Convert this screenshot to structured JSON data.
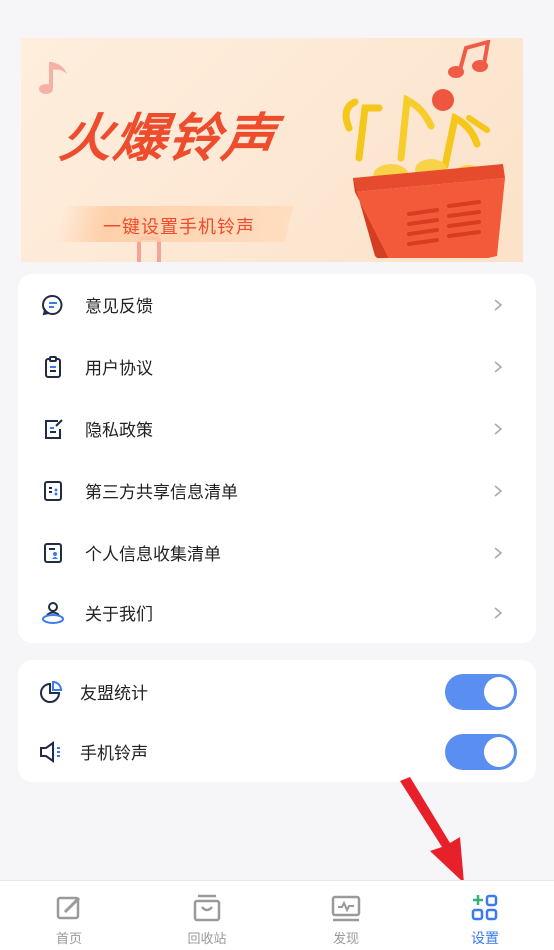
{
  "banner": {
    "title": "火爆铃声",
    "subtitle": "一键设置手机铃声"
  },
  "menu": {
    "items": [
      {
        "label": "意见反馈",
        "icon": "feedback-icon"
      },
      {
        "label": "用户协议",
        "icon": "clipboard-icon"
      },
      {
        "label": "隐私政策",
        "icon": "edit-document-icon"
      },
      {
        "label": "第三方共享信息清单",
        "icon": "share-list-icon"
      },
      {
        "label": "个人信息收集清单",
        "icon": "personal-info-icon"
      },
      {
        "label": "关于我们",
        "icon": "about-icon"
      }
    ]
  },
  "toggles": {
    "items": [
      {
        "label": "友盟统计",
        "icon": "pie-chart-icon",
        "on": true
      },
      {
        "label": "手机铃声",
        "icon": "speaker-icon",
        "on": true
      }
    ]
  },
  "nav": {
    "items": [
      {
        "label": "首页",
        "icon": "edit-icon",
        "active": false
      },
      {
        "label": "回收站",
        "icon": "recycle-bin-icon",
        "active": false
      },
      {
        "label": "发现",
        "icon": "monitor-icon",
        "active": false
      },
      {
        "label": "设置",
        "icon": "grid-plus-icon",
        "active": true
      }
    ]
  },
  "colors": {
    "accent": "#5a8ef0",
    "active_nav": "#3a7bf0",
    "banner_text": "#ee4d2d",
    "arrow": "#e8202a"
  }
}
